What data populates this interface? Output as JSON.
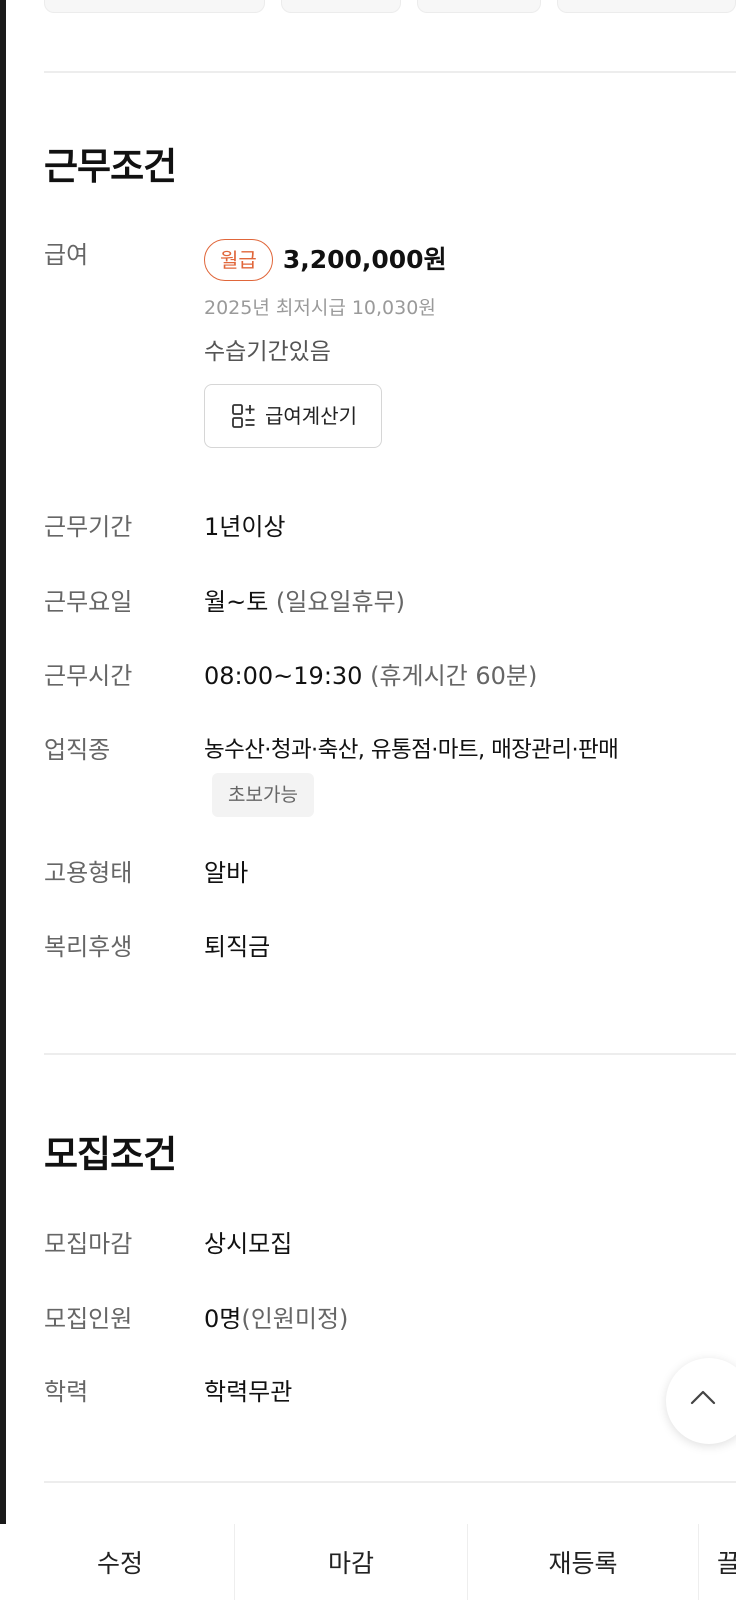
{
  "conditions": {
    "title": "근무조건",
    "pay": {
      "label": "급여",
      "badge": "월급",
      "amount": "3,200,000원",
      "min_wage": "2025년 최저시급 10,030원",
      "training": "수습기간있음",
      "calc_button_label": "급여계산기",
      "calc_icon": "calculator-icon"
    },
    "period": {
      "label": "근무기간",
      "value": "1년이상"
    },
    "days": {
      "label": "근무요일",
      "value": "월~토",
      "note": " (일요일휴무)"
    },
    "hours": {
      "label": "근무시간",
      "value": "08:00~19:30",
      "note": " (휴게시간 60분)"
    },
    "job_type": {
      "label": "업직종",
      "value": "농수산·청과·축산, 유통점·마트, 매장관리·판매",
      "tag": "초보가능"
    },
    "employment": {
      "label": "고용형태",
      "value": "알바"
    },
    "benefits": {
      "label": "복리후생",
      "value": "퇴직금"
    }
  },
  "recruit": {
    "title": "모집조건",
    "deadline": {
      "label": "모집마감",
      "value": "상시모집"
    },
    "headcount": {
      "label": "모집인원",
      "value": "0명",
      "note": "(인원미정)"
    },
    "education": {
      "label": "학력",
      "value": "학력무관"
    }
  },
  "scroll_top_icon": "chevron-up-icon",
  "bottom_bar": {
    "edit_label": "수정",
    "close_label": "마감",
    "repost_label": "재등록",
    "cut_label": "끌"
  },
  "colors": {
    "accent": "#e0663a",
    "label": "#666666",
    "divider": "#ededed"
  }
}
